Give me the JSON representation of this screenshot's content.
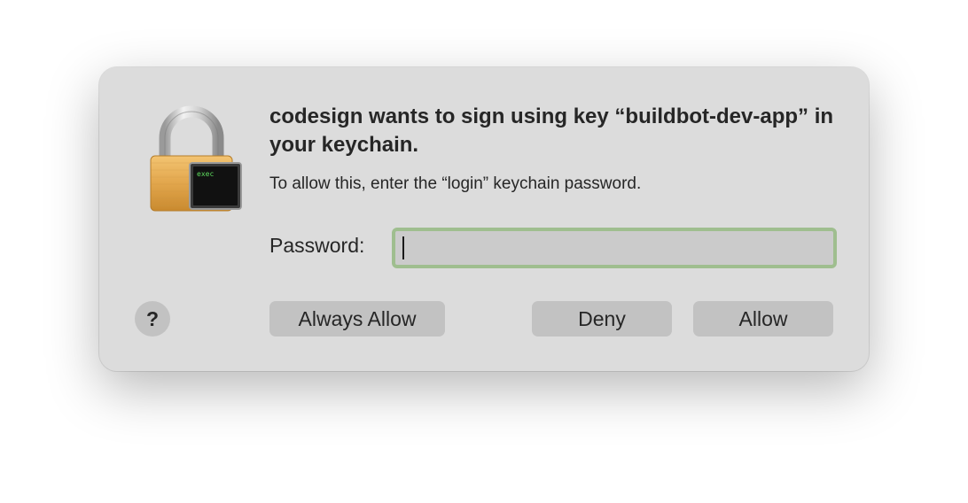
{
  "dialog": {
    "title": "codesign wants to sign using key “buildbot-dev-app” in your keychain.",
    "message": "To allow this, enter the “login” keychain password.",
    "icon": "lock-with-terminal-icon",
    "icon_terminal_text": "exec",
    "password": {
      "label": "Password:",
      "value": "",
      "focused": true,
      "focus_ring_color": "#9fbe8f"
    },
    "help_label": "?",
    "buttons": {
      "always_allow": "Always Allow",
      "deny": "Deny",
      "allow": "Allow"
    }
  }
}
